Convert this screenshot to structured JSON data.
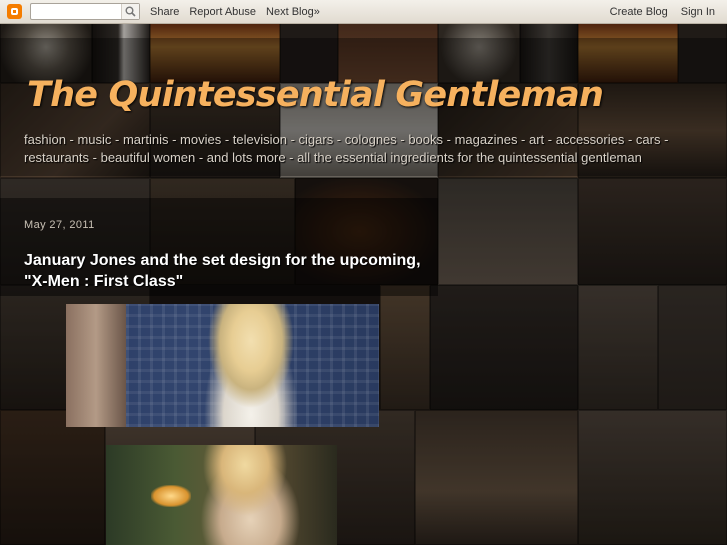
{
  "navbar": {
    "search_placeholder": "",
    "share": "Share",
    "report_abuse": "Report Abuse",
    "next_blog": "Next Blog»",
    "create_blog": "Create Blog",
    "sign_in": "Sign In",
    "logo_icon": "blogger-logo-icon",
    "search_icon": "search-icon"
  },
  "header": {
    "title": "The Quintessential Gentleman",
    "description": "fashion - music - martinis - movies - television - cigars - colognes - books - magazines - art - accessories - cars - restaurants - beautiful women - and lots more - all the essential ingredients for the quintessential gentleman"
  },
  "post": {
    "date": "May 27, 2011",
    "title": "January Jones and the set design for the upcoming, \"X-Men : First Class\""
  },
  "colors": {
    "title_accent": "#f6b15e",
    "navbar_bg": "#e9e4db"
  }
}
